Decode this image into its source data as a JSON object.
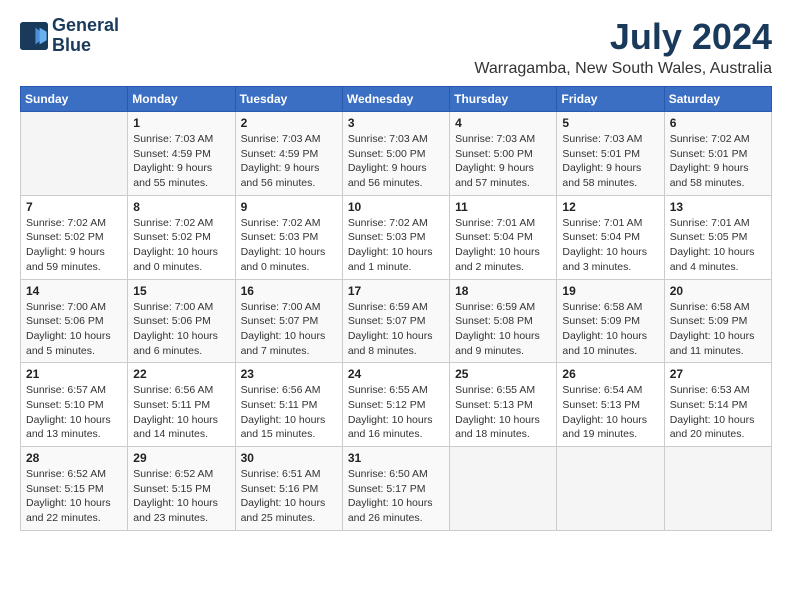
{
  "logo": {
    "line1": "General",
    "line2": "Blue"
  },
  "title": "July 2024",
  "subtitle": "Warragamba, New South Wales, Australia",
  "weekdays": [
    "Sunday",
    "Monday",
    "Tuesday",
    "Wednesday",
    "Thursday",
    "Friday",
    "Saturday"
  ],
  "weeks": [
    [
      {
        "day": "",
        "info": ""
      },
      {
        "day": "1",
        "info": "Sunrise: 7:03 AM\nSunset: 4:59 PM\nDaylight: 9 hours\nand 55 minutes."
      },
      {
        "day": "2",
        "info": "Sunrise: 7:03 AM\nSunset: 4:59 PM\nDaylight: 9 hours\nand 56 minutes."
      },
      {
        "day": "3",
        "info": "Sunrise: 7:03 AM\nSunset: 5:00 PM\nDaylight: 9 hours\nand 56 minutes."
      },
      {
        "day": "4",
        "info": "Sunrise: 7:03 AM\nSunset: 5:00 PM\nDaylight: 9 hours\nand 57 minutes."
      },
      {
        "day": "5",
        "info": "Sunrise: 7:03 AM\nSunset: 5:01 PM\nDaylight: 9 hours\nand 58 minutes."
      },
      {
        "day": "6",
        "info": "Sunrise: 7:02 AM\nSunset: 5:01 PM\nDaylight: 9 hours\nand 58 minutes."
      }
    ],
    [
      {
        "day": "7",
        "info": "Sunrise: 7:02 AM\nSunset: 5:02 PM\nDaylight: 9 hours\nand 59 minutes."
      },
      {
        "day": "8",
        "info": "Sunrise: 7:02 AM\nSunset: 5:02 PM\nDaylight: 10 hours\nand 0 minutes."
      },
      {
        "day": "9",
        "info": "Sunrise: 7:02 AM\nSunset: 5:03 PM\nDaylight: 10 hours\nand 0 minutes."
      },
      {
        "day": "10",
        "info": "Sunrise: 7:02 AM\nSunset: 5:03 PM\nDaylight: 10 hours\nand 1 minute."
      },
      {
        "day": "11",
        "info": "Sunrise: 7:01 AM\nSunset: 5:04 PM\nDaylight: 10 hours\nand 2 minutes."
      },
      {
        "day": "12",
        "info": "Sunrise: 7:01 AM\nSunset: 5:04 PM\nDaylight: 10 hours\nand 3 minutes."
      },
      {
        "day": "13",
        "info": "Sunrise: 7:01 AM\nSunset: 5:05 PM\nDaylight: 10 hours\nand 4 minutes."
      }
    ],
    [
      {
        "day": "14",
        "info": "Sunrise: 7:00 AM\nSunset: 5:06 PM\nDaylight: 10 hours\nand 5 minutes."
      },
      {
        "day": "15",
        "info": "Sunrise: 7:00 AM\nSunset: 5:06 PM\nDaylight: 10 hours\nand 6 minutes."
      },
      {
        "day": "16",
        "info": "Sunrise: 7:00 AM\nSunset: 5:07 PM\nDaylight: 10 hours\nand 7 minutes."
      },
      {
        "day": "17",
        "info": "Sunrise: 6:59 AM\nSunset: 5:07 PM\nDaylight: 10 hours\nand 8 minutes."
      },
      {
        "day": "18",
        "info": "Sunrise: 6:59 AM\nSunset: 5:08 PM\nDaylight: 10 hours\nand 9 minutes."
      },
      {
        "day": "19",
        "info": "Sunrise: 6:58 AM\nSunset: 5:09 PM\nDaylight: 10 hours\nand 10 minutes."
      },
      {
        "day": "20",
        "info": "Sunrise: 6:58 AM\nSunset: 5:09 PM\nDaylight: 10 hours\nand 11 minutes."
      }
    ],
    [
      {
        "day": "21",
        "info": "Sunrise: 6:57 AM\nSunset: 5:10 PM\nDaylight: 10 hours\nand 13 minutes."
      },
      {
        "day": "22",
        "info": "Sunrise: 6:56 AM\nSunset: 5:11 PM\nDaylight: 10 hours\nand 14 minutes."
      },
      {
        "day": "23",
        "info": "Sunrise: 6:56 AM\nSunset: 5:11 PM\nDaylight: 10 hours\nand 15 minutes."
      },
      {
        "day": "24",
        "info": "Sunrise: 6:55 AM\nSunset: 5:12 PM\nDaylight: 10 hours\nand 16 minutes."
      },
      {
        "day": "25",
        "info": "Sunrise: 6:55 AM\nSunset: 5:13 PM\nDaylight: 10 hours\nand 18 minutes."
      },
      {
        "day": "26",
        "info": "Sunrise: 6:54 AM\nSunset: 5:13 PM\nDaylight: 10 hours\nand 19 minutes."
      },
      {
        "day": "27",
        "info": "Sunrise: 6:53 AM\nSunset: 5:14 PM\nDaylight: 10 hours\nand 20 minutes."
      }
    ],
    [
      {
        "day": "28",
        "info": "Sunrise: 6:52 AM\nSunset: 5:15 PM\nDaylight: 10 hours\nand 22 minutes."
      },
      {
        "day": "29",
        "info": "Sunrise: 6:52 AM\nSunset: 5:15 PM\nDaylight: 10 hours\nand 23 minutes."
      },
      {
        "day": "30",
        "info": "Sunrise: 6:51 AM\nSunset: 5:16 PM\nDaylight: 10 hours\nand 25 minutes."
      },
      {
        "day": "31",
        "info": "Sunrise: 6:50 AM\nSunset: 5:17 PM\nDaylight: 10 hours\nand 26 minutes."
      },
      {
        "day": "",
        "info": ""
      },
      {
        "day": "",
        "info": ""
      },
      {
        "day": "",
        "info": ""
      }
    ]
  ]
}
